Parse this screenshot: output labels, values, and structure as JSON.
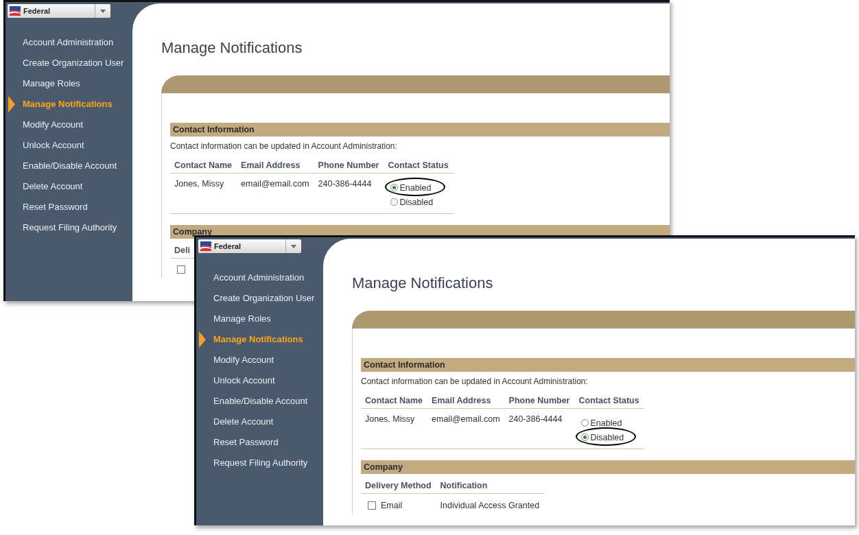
{
  "panels": [
    {
      "org_selector": "Federal",
      "nav": [
        {
          "label": "Account Administration",
          "selected": false
        },
        {
          "label": "Create Organization User",
          "selected": false
        },
        {
          "label": "Manage Roles",
          "selected": false
        },
        {
          "label": "Manage Notifications",
          "selected": true
        },
        {
          "label": "Modify Account",
          "selected": false
        },
        {
          "label": "Unlock Account",
          "selected": false
        },
        {
          "label": "Enable/Disable Account",
          "selected": false
        },
        {
          "label": "Delete Account",
          "selected": false
        },
        {
          "label": "Reset Password",
          "selected": false
        },
        {
          "label": "Request Filing Authority",
          "selected": false
        }
      ],
      "title": "Manage Notifications",
      "contact": {
        "heading": "Contact Information",
        "note": "Contact information can be updated in Account Administration:",
        "columns": [
          "Contact Name",
          "Email Address",
          "Phone Number",
          "Contact Status"
        ],
        "row": {
          "name": "Jones, Missy",
          "email": "email@email.com",
          "phone": "240-386-4444"
        },
        "status_options": [
          {
            "label": "Enabled",
            "selected": true
          },
          {
            "label": "Disabled",
            "selected": false
          }
        ]
      },
      "company": {
        "heading": "Company",
        "columns": [
          "Deli"
        ],
        "rows": [
          {
            "checked": false
          }
        ]
      }
    },
    {
      "org_selector": "Federal",
      "nav": [
        {
          "label": "Account Administration",
          "selected": false
        },
        {
          "label": "Create Organization User",
          "selected": false
        },
        {
          "label": "Manage Roles",
          "selected": false
        },
        {
          "label": "Manage Notifications",
          "selected": true
        },
        {
          "label": "Modify Account",
          "selected": false
        },
        {
          "label": "Unlock Account",
          "selected": false
        },
        {
          "label": "Enable/Disable Account",
          "selected": false
        },
        {
          "label": "Delete Account",
          "selected": false
        },
        {
          "label": "Reset Password",
          "selected": false
        },
        {
          "label": "Request Filing Authority",
          "selected": false
        }
      ],
      "title": "Manage Notifications",
      "contact": {
        "heading": "Contact Information",
        "note": "Contact information can be updated in Account Administration:",
        "columns": [
          "Contact Name",
          "Email Address",
          "Phone Number",
          "Contact Status"
        ],
        "row": {
          "name": "Jones, Missy",
          "email": "email@email.com",
          "phone": "240-386-4444"
        },
        "status_options": [
          {
            "label": "Enabled",
            "selected": false
          },
          {
            "label": "Disabled",
            "selected": true
          }
        ]
      },
      "company": {
        "heading": "Company",
        "columns": [
          "Delivery Method",
          "Notification"
        ],
        "rows": [
          {
            "checked": false,
            "method": "Email",
            "notification": "Individual Access Granted"
          }
        ]
      }
    }
  ]
}
